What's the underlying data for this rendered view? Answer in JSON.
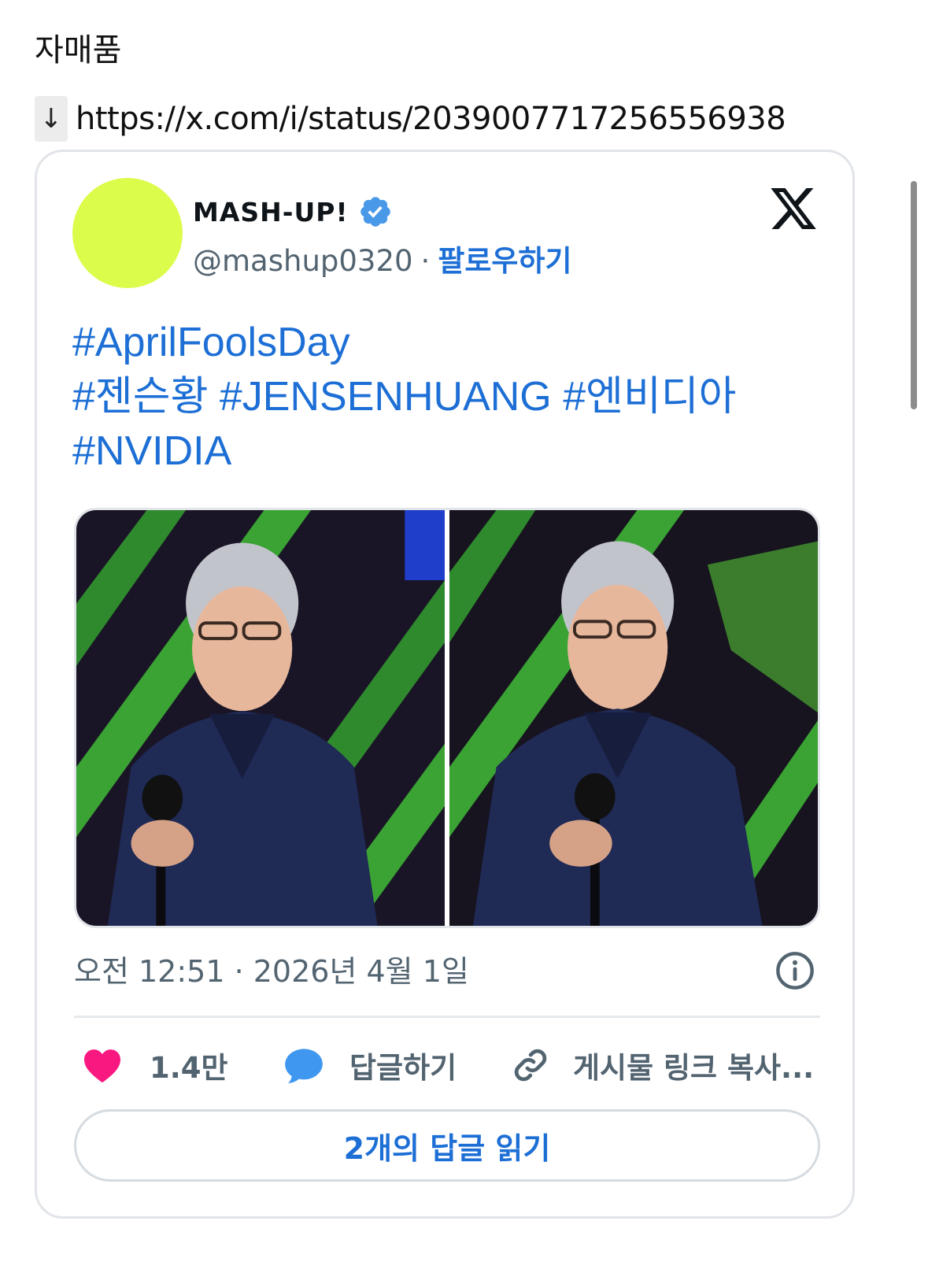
{
  "page": {
    "title": "자매품",
    "link_arrow": "↓",
    "link_url": "https://x.com/i/status/2039007717256556938"
  },
  "tweet": {
    "display_name": "MASH-UP!",
    "handle": "@mashup0320",
    "separator": "·",
    "follow_label": "팔로우하기",
    "text_lines": [
      "#AprilFoolsDay",
      "#젠슨황 #JENSENHUANG #엔비디아",
      "#NVIDIA"
    ],
    "timestamp": "오전 12:51 · 2026년 4월 1일",
    "like_count": "1.4만",
    "reply_label": "답글하기",
    "copy_link_label": "게시물 링크 복사...",
    "read_replies_label": "2개의 답글 읽기",
    "photos": [
      {
        "icon": "photo-jensen-huang-stage-1"
      },
      {
        "icon": "photo-jensen-huang-stage-2"
      }
    ]
  },
  "colors": {
    "link_blue": "#1d6fd6",
    "avatar": "#dcfc4b",
    "like_heart": "#f91880",
    "reply_bubble": "#3f97f0",
    "verified_badge": "#4a99e9"
  }
}
